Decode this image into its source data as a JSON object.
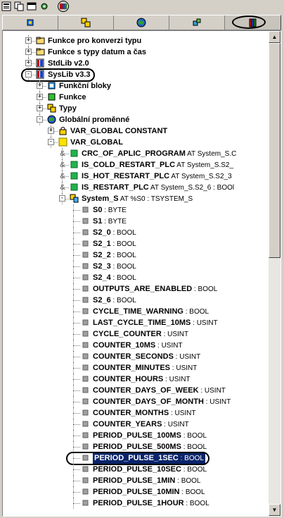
{
  "toolbar": {
    "buttons": [
      {
        "name": "pou-list-icon"
      },
      {
        "name": "copy-icon"
      },
      {
        "name": "window-icon"
      },
      {
        "name": "settings-icon"
      },
      {
        "name": "library-icon"
      }
    ]
  },
  "tabs": [
    {
      "name": "tab-pou",
      "icon": "pou-icon"
    },
    {
      "name": "tab-datatypes",
      "icon": "datatypes-icon"
    },
    {
      "name": "tab-visualization",
      "icon": "globe-icon"
    },
    {
      "name": "tab-resources",
      "icon": "resources-icon"
    },
    {
      "name": "tab-library",
      "icon": "books-icon",
      "selected": true
    }
  ],
  "tree": [
    {
      "level": 1,
      "exp": "+",
      "icon": "folder",
      "name": "Funkce pro konverzi typu",
      "ann": ""
    },
    {
      "level": 1,
      "exp": "+",
      "icon": "folder",
      "name": "Funkce s typy datum a čas",
      "ann": ""
    },
    {
      "level": 1,
      "exp": "+",
      "icon": "lib",
      "name": "StdLib v2.0",
      "ann": ""
    },
    {
      "level": 1,
      "exp": "-",
      "icon": "lib",
      "name": "SysLib v3.3",
      "ann": "",
      "oval": true
    },
    {
      "level": 2,
      "exp": "+",
      "icon": "fb",
      "name": "Funkční bloky",
      "ann": ""
    },
    {
      "level": 2,
      "exp": "+",
      "icon": "fn",
      "name": "Funkce",
      "ann": ""
    },
    {
      "level": 2,
      "exp": "+",
      "icon": "types",
      "name": "Typy",
      "ann": ""
    },
    {
      "level": 2,
      "exp": "-",
      "icon": "globe",
      "name": "Globální proměnné",
      "ann": ""
    },
    {
      "level": 3,
      "exp": "+",
      "icon": "lock",
      "name": "VAR_GLOBAL CONSTANT",
      "ann": ""
    },
    {
      "level": 3,
      "exp": "-",
      "icon": "yellow",
      "name": "VAR_GLOBAL",
      "ann": ""
    },
    {
      "level": 4,
      "exp": "",
      "amp": true,
      "icon": "green",
      "name": "CRC_OF_APLIC_PROGRAM",
      "ann": " AT System_S.C"
    },
    {
      "level": 4,
      "exp": "",
      "amp": true,
      "icon": "green",
      "name": "IS_COLD_RESTART_PLC",
      "ann": " AT System_S.S2_"
    },
    {
      "level": 4,
      "exp": "",
      "amp": true,
      "icon": "green",
      "name": "IS_HOT_RESTART_PLC",
      "ann": " AT System_S.S2_3"
    },
    {
      "level": 4,
      "exp": "",
      "amp": true,
      "icon": "green",
      "name": "IS_RESTART_PLC",
      "ann": " AT System_S.S2_6 : BOOl"
    },
    {
      "level": 4,
      "exp": "-",
      "icon": "struct",
      "name": "System_S",
      "ann": " AT %S0 : TSYSTEM_S"
    },
    {
      "level": 5,
      "exp": "",
      "icon": "gray",
      "name": "S0",
      "ann": " : BYTE"
    },
    {
      "level": 5,
      "exp": "",
      "icon": "gray",
      "name": "S1",
      "ann": " : BYTE"
    },
    {
      "level": 5,
      "exp": "",
      "icon": "gray",
      "name": "S2_0",
      "ann": " : BOOL"
    },
    {
      "level": 5,
      "exp": "",
      "icon": "gray",
      "name": "S2_1",
      "ann": " : BOOL"
    },
    {
      "level": 5,
      "exp": "",
      "icon": "gray",
      "name": "S2_2",
      "ann": " : BOOL"
    },
    {
      "level": 5,
      "exp": "",
      "icon": "gray",
      "name": "S2_3",
      "ann": " : BOOL"
    },
    {
      "level": 5,
      "exp": "",
      "icon": "gray",
      "name": "S2_4",
      "ann": " : BOOL"
    },
    {
      "level": 5,
      "exp": "",
      "icon": "gray",
      "name": "OUTPUTS_ARE_ENABLED",
      "ann": " : BOOL"
    },
    {
      "level": 5,
      "exp": "",
      "icon": "gray",
      "name": "S2_6",
      "ann": " : BOOL"
    },
    {
      "level": 5,
      "exp": "",
      "icon": "gray",
      "name": "CYCLE_TIME_WARNING",
      "ann": " : BOOL"
    },
    {
      "level": 5,
      "exp": "",
      "icon": "gray",
      "name": "LAST_CYCLE_TIME_10MS",
      "ann": " : USINT"
    },
    {
      "level": 5,
      "exp": "",
      "icon": "gray",
      "name": "CYCLE_COUNTER",
      "ann": " : USINT"
    },
    {
      "level": 5,
      "exp": "",
      "icon": "gray",
      "name": "COUNTER_10MS",
      "ann": " : USINT"
    },
    {
      "level": 5,
      "exp": "",
      "icon": "gray",
      "name": "COUNTER_SECONDS",
      "ann": " : USINT"
    },
    {
      "level": 5,
      "exp": "",
      "icon": "gray",
      "name": "COUNTER_MINUTES",
      "ann": " : USINT"
    },
    {
      "level": 5,
      "exp": "",
      "icon": "gray",
      "name": "COUNTER_HOURS",
      "ann": " : USINT"
    },
    {
      "level": 5,
      "exp": "",
      "icon": "gray",
      "name": "COUNTER_DAYS_OF_WEEK",
      "ann": " : USINT"
    },
    {
      "level": 5,
      "exp": "",
      "icon": "gray",
      "name": "COUNTER_DAYS_OF_MONTH",
      "ann": " : USINT"
    },
    {
      "level": 5,
      "exp": "",
      "icon": "gray",
      "name": "COUNTER_MONTHS",
      "ann": " : USINT"
    },
    {
      "level": 5,
      "exp": "",
      "icon": "gray",
      "name": "COUNTER_YEARS",
      "ann": " : USINT"
    },
    {
      "level": 5,
      "exp": "",
      "icon": "gray",
      "name": "PERIOD_PULSE_100MS",
      "ann": " : BOOL"
    },
    {
      "level": 5,
      "exp": "",
      "icon": "gray",
      "name": "PERIOD_PULSE_500MS",
      "ann": " : BOOL"
    },
    {
      "level": 5,
      "exp": "",
      "icon": "gray",
      "name": "PERIOD_PULSE_1SEC",
      "ann": " : BOOL",
      "selected": true,
      "oval": true
    },
    {
      "level": 5,
      "exp": "",
      "icon": "gray",
      "name": "PERIOD_PULSE_10SEC",
      "ann": " : BOOL"
    },
    {
      "level": 5,
      "exp": "",
      "icon": "gray",
      "name": "PERIOD_PULSE_1MIN",
      "ann": " : BOOL"
    },
    {
      "level": 5,
      "exp": "",
      "icon": "gray",
      "name": "PERIOD_PULSE_10MIN",
      "ann": " : BOOL"
    },
    {
      "level": 5,
      "exp": "",
      "icon": "gray",
      "name": "PERIOD_PULSE_1HOUR",
      "ann": " : BOOL"
    }
  ],
  "colors": {
    "selection": "#0a246a",
    "green_var": "#22b24c",
    "yellow_folder": "#ffe000"
  }
}
